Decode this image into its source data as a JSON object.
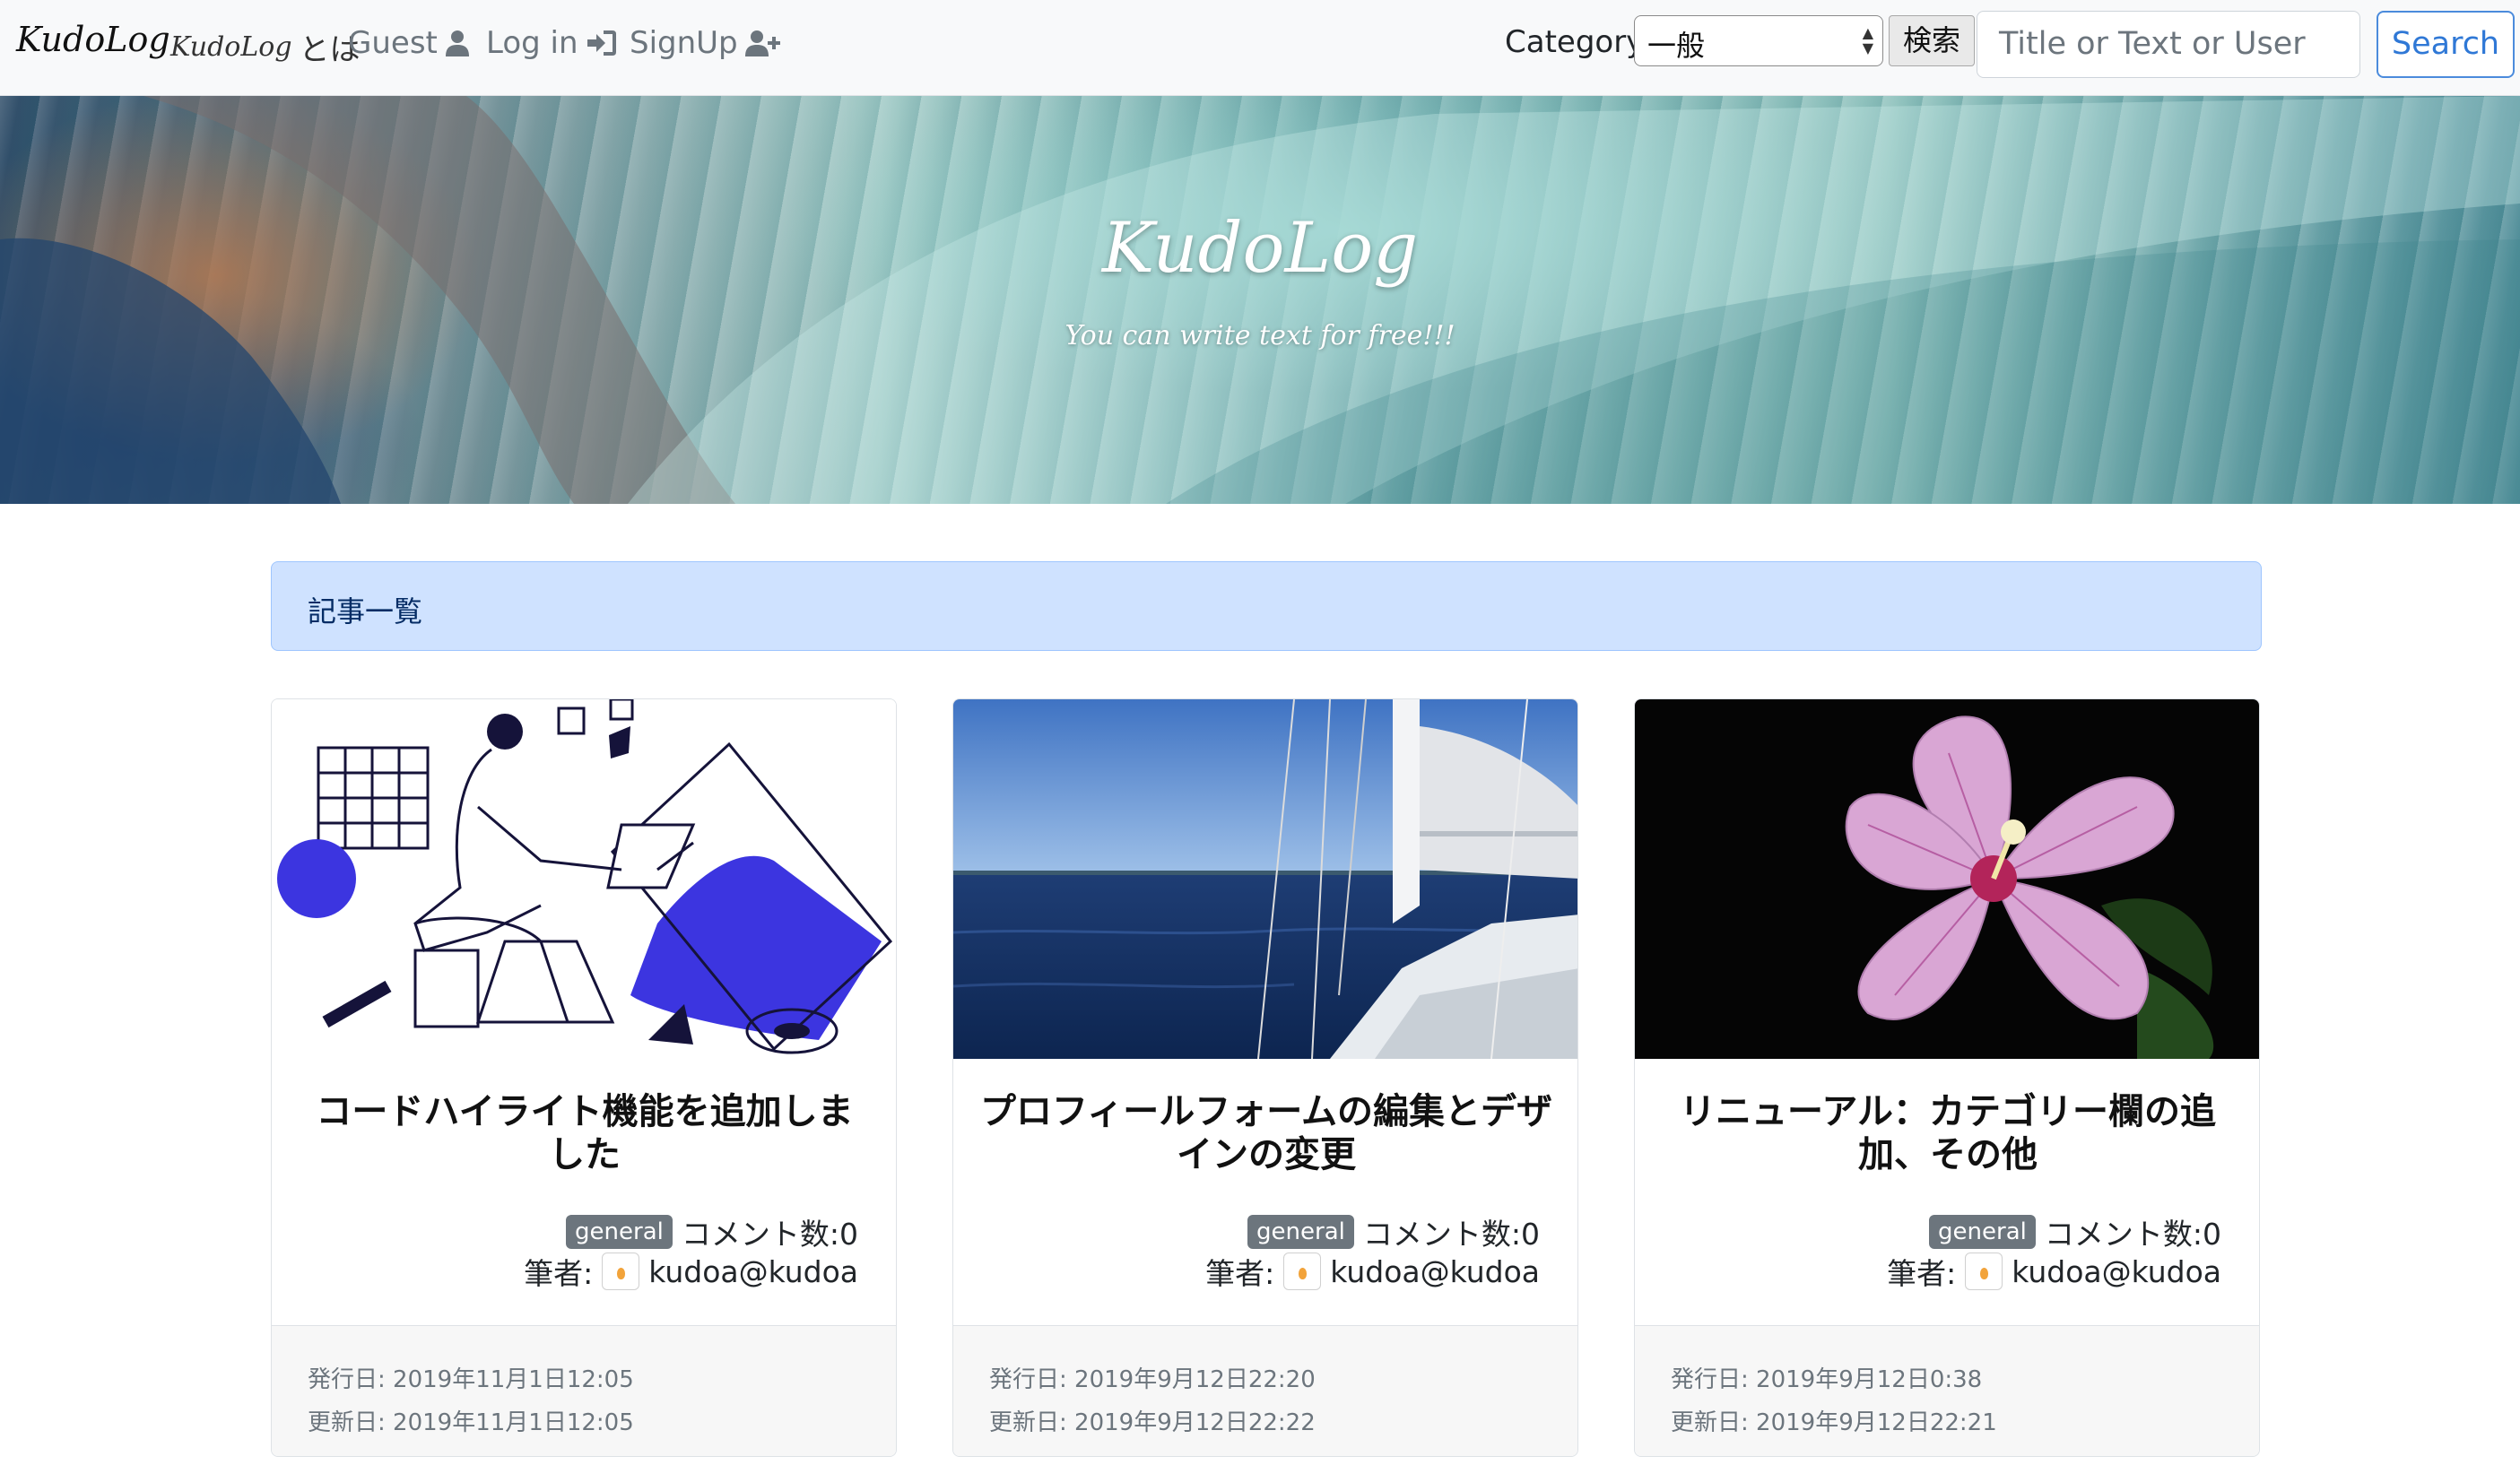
{
  "navbar": {
    "brand": "KudoLog",
    "about_script": "KudoLog",
    "about_suffix": "とは",
    "guest": "Guest",
    "login": "Log in",
    "signup": "SignUp",
    "category_label": "Category:",
    "category_selected": "一般",
    "kensaku_button": "検索",
    "search_placeholder": "Title or Text or User",
    "search_button": "Search"
  },
  "hero": {
    "title": "KudoLog",
    "subtitle": "You can write text for free!!!"
  },
  "list_header": "記事一覧",
  "cards": [
    {
      "title": "コードハイライト機能を追加しました",
      "badge": "general",
      "comments": "コメント数:0",
      "author_label": "筆者:",
      "author": "kudoa@kudoa",
      "published": "発行日: 2019年11月1日12:05",
      "updated": "更新日: 2019年11月1日12:05"
    },
    {
      "title": "プロフィールフォームの編集とデザインの変更",
      "badge": "general",
      "comments": "コメント数:0",
      "author_label": "筆者:",
      "author": "kudoa@kudoa",
      "published": "発行日: 2019年9月12日22:20",
      "updated": "更新日: 2019年9月12日22:22"
    },
    {
      "title": "リニューアル：カテゴリー欄の追加、その他",
      "badge": "general",
      "comments": "コメント数:0",
      "author_label": "筆者:",
      "author": "kudoa@kudoa",
      "published": "発行日: 2019年9月12日0:38",
      "updated": "更新日: 2019年9月12日22:21"
    }
  ],
  "icons": {
    "guest": "user-icon",
    "login": "sign-in-icon",
    "signup": "user-plus-icon"
  },
  "colors": {
    "navbar_bg": "#f8f9fa",
    "header_bg": "#cfe2ff",
    "badge_bg": "#6c757d",
    "search_button": "#2f78d6",
    "illustration_accent": "#3c35e0"
  }
}
